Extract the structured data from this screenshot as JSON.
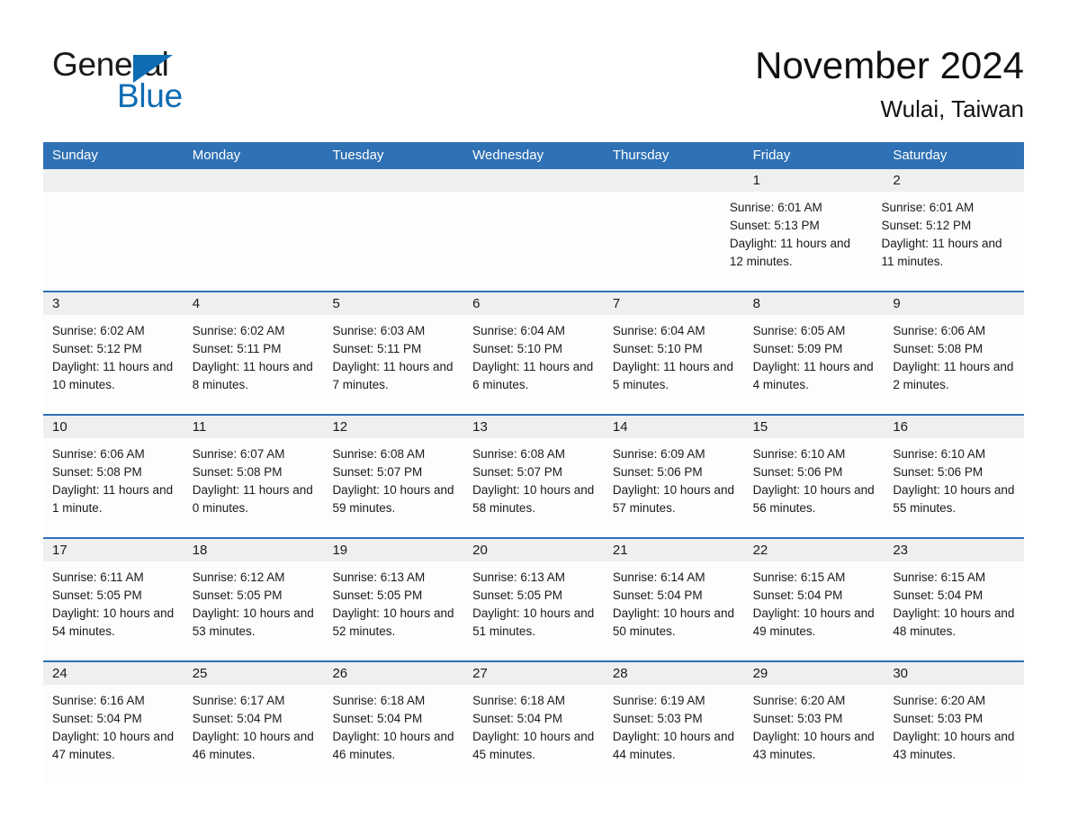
{
  "brand": {
    "name_part1": "General",
    "name_part2": "Blue",
    "triangle_color": "#0d6cb4"
  },
  "header": {
    "title": "November 2024",
    "subtitle": "Wulai, Taiwan",
    "accent_color": "#2e71b5",
    "daynum_band_color": "#efefef"
  },
  "weekdays": [
    "Sunday",
    "Monday",
    "Tuesday",
    "Wednesday",
    "Thursday",
    "Friday",
    "Saturday"
  ],
  "labels": {
    "sunrise_prefix": "Sunrise:",
    "sunset_prefix": "Sunset:",
    "daylight_prefix": "Daylight:"
  },
  "weeks": [
    [
      {
        "day": "",
        "lines": []
      },
      {
        "day": "",
        "lines": []
      },
      {
        "day": "",
        "lines": []
      },
      {
        "day": "",
        "lines": []
      },
      {
        "day": "",
        "lines": []
      },
      {
        "day": "1",
        "lines": [
          "Sunrise: 6:01 AM",
          "Sunset: 5:13 PM",
          "Daylight: 11 hours and 12 minutes."
        ]
      },
      {
        "day": "2",
        "lines": [
          "Sunrise: 6:01 AM",
          "Sunset: 5:12 PM",
          "Daylight: 11 hours and 11 minutes."
        ]
      }
    ],
    [
      {
        "day": "3",
        "lines": [
          "Sunrise: 6:02 AM",
          "Sunset: 5:12 PM",
          "Daylight: 11 hours and 10 minutes."
        ]
      },
      {
        "day": "4",
        "lines": [
          "Sunrise: 6:02 AM",
          "Sunset: 5:11 PM",
          "Daylight: 11 hours and 8 minutes."
        ]
      },
      {
        "day": "5",
        "lines": [
          "Sunrise: 6:03 AM",
          "Sunset: 5:11 PM",
          "Daylight: 11 hours and 7 minutes."
        ]
      },
      {
        "day": "6",
        "lines": [
          "Sunrise: 6:04 AM",
          "Sunset: 5:10 PM",
          "Daylight: 11 hours and 6 minutes."
        ]
      },
      {
        "day": "7",
        "lines": [
          "Sunrise: 6:04 AM",
          "Sunset: 5:10 PM",
          "Daylight: 11 hours and 5 minutes."
        ]
      },
      {
        "day": "8",
        "lines": [
          "Sunrise: 6:05 AM",
          "Sunset: 5:09 PM",
          "Daylight: 11 hours and 4 minutes."
        ]
      },
      {
        "day": "9",
        "lines": [
          "Sunrise: 6:06 AM",
          "Sunset: 5:08 PM",
          "Daylight: 11 hours and 2 minutes."
        ]
      }
    ],
    [
      {
        "day": "10",
        "lines": [
          "Sunrise: 6:06 AM",
          "Sunset: 5:08 PM",
          "Daylight: 11 hours and 1 minute."
        ]
      },
      {
        "day": "11",
        "lines": [
          "Sunrise: 6:07 AM",
          "Sunset: 5:08 PM",
          "Daylight: 11 hours and 0 minutes."
        ]
      },
      {
        "day": "12",
        "lines": [
          "Sunrise: 6:08 AM",
          "Sunset: 5:07 PM",
          "Daylight: 10 hours and 59 minutes."
        ]
      },
      {
        "day": "13",
        "lines": [
          "Sunrise: 6:08 AM",
          "Sunset: 5:07 PM",
          "Daylight: 10 hours and 58 minutes."
        ]
      },
      {
        "day": "14",
        "lines": [
          "Sunrise: 6:09 AM",
          "Sunset: 5:06 PM",
          "Daylight: 10 hours and 57 minutes."
        ]
      },
      {
        "day": "15",
        "lines": [
          "Sunrise: 6:10 AM",
          "Sunset: 5:06 PM",
          "Daylight: 10 hours and 56 minutes."
        ]
      },
      {
        "day": "16",
        "lines": [
          "Sunrise: 6:10 AM",
          "Sunset: 5:06 PM",
          "Daylight: 10 hours and 55 minutes."
        ]
      }
    ],
    [
      {
        "day": "17",
        "lines": [
          "Sunrise: 6:11 AM",
          "Sunset: 5:05 PM",
          "Daylight: 10 hours and 54 minutes."
        ]
      },
      {
        "day": "18",
        "lines": [
          "Sunrise: 6:12 AM",
          "Sunset: 5:05 PM",
          "Daylight: 10 hours and 53 minutes."
        ]
      },
      {
        "day": "19",
        "lines": [
          "Sunrise: 6:13 AM",
          "Sunset: 5:05 PM",
          "Daylight: 10 hours and 52 minutes."
        ]
      },
      {
        "day": "20",
        "lines": [
          "Sunrise: 6:13 AM",
          "Sunset: 5:05 PM",
          "Daylight: 10 hours and 51 minutes."
        ]
      },
      {
        "day": "21",
        "lines": [
          "Sunrise: 6:14 AM",
          "Sunset: 5:04 PM",
          "Daylight: 10 hours and 50 minutes."
        ]
      },
      {
        "day": "22",
        "lines": [
          "Sunrise: 6:15 AM",
          "Sunset: 5:04 PM",
          "Daylight: 10 hours and 49 minutes."
        ]
      },
      {
        "day": "23",
        "lines": [
          "Sunrise: 6:15 AM",
          "Sunset: 5:04 PM",
          "Daylight: 10 hours and 48 minutes."
        ]
      }
    ],
    [
      {
        "day": "24",
        "lines": [
          "Sunrise: 6:16 AM",
          "Sunset: 5:04 PM",
          "Daylight: 10 hours and 47 minutes."
        ]
      },
      {
        "day": "25",
        "lines": [
          "Sunrise: 6:17 AM",
          "Sunset: 5:04 PM",
          "Daylight: 10 hours and 46 minutes."
        ]
      },
      {
        "day": "26",
        "lines": [
          "Sunrise: 6:18 AM",
          "Sunset: 5:04 PM",
          "Daylight: 10 hours and 46 minutes."
        ]
      },
      {
        "day": "27",
        "lines": [
          "Sunrise: 6:18 AM",
          "Sunset: 5:04 PM",
          "Daylight: 10 hours and 45 minutes."
        ]
      },
      {
        "day": "28",
        "lines": [
          "Sunrise: 6:19 AM",
          "Sunset: 5:03 PM",
          "Daylight: 10 hours and 44 minutes."
        ]
      },
      {
        "day": "29",
        "lines": [
          "Sunrise: 6:20 AM",
          "Sunset: 5:03 PM",
          "Daylight: 10 hours and 43 minutes."
        ]
      },
      {
        "day": "30",
        "lines": [
          "Sunrise: 6:20 AM",
          "Sunset: 5:03 PM",
          "Daylight: 10 hours and 43 minutes."
        ]
      }
    ]
  ]
}
